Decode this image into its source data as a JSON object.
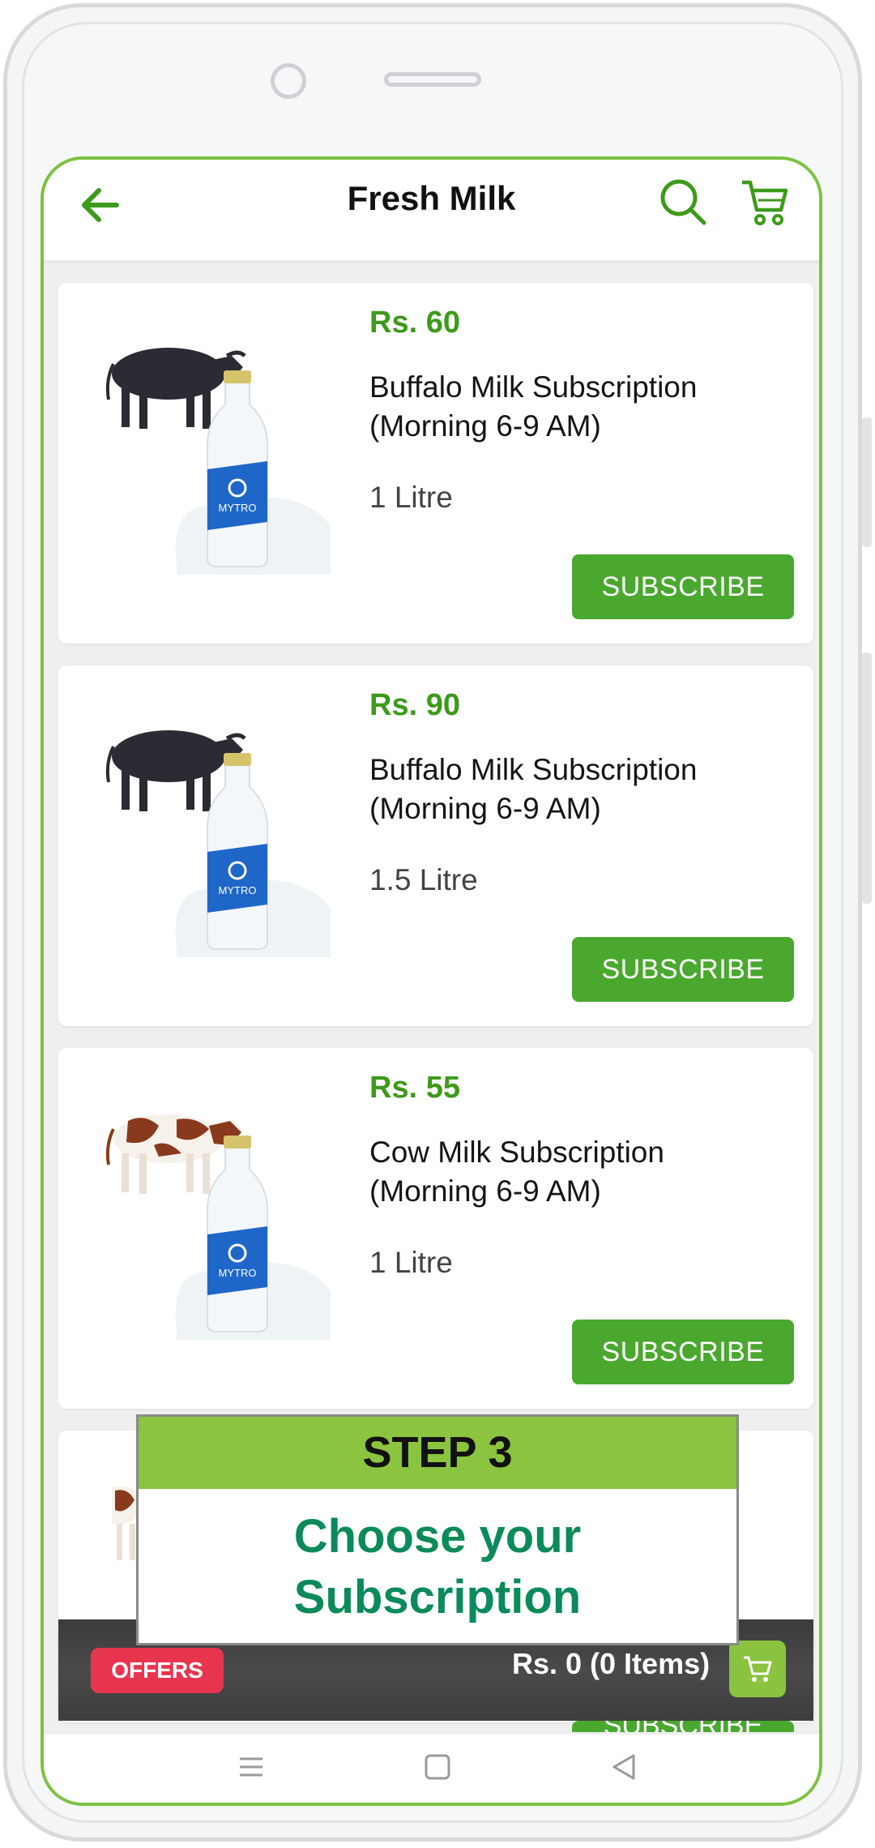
{
  "header": {
    "title": "Fresh Milk"
  },
  "products": [
    {
      "price": "Rs. 60",
      "name_line1": "Buffalo Milk Subscription",
      "name_line2": "(Morning 6-9 AM)",
      "quantity": "1 Litre",
      "button": "SUBSCRIBE",
      "animal": "buffalo"
    },
    {
      "price": "Rs. 90",
      "name_line1": "Buffalo Milk Subscription",
      "name_line2": "(Morning 6-9 AM)",
      "quantity": "1.5 Litre",
      "button": "SUBSCRIBE",
      "animal": "buffalo"
    },
    {
      "price": "Rs. 55",
      "name_line1": "Cow Milk Subscription",
      "name_line2": "(Morning 6-9 AM)",
      "quantity": "1 Litre",
      "button": "SUBSCRIBE",
      "animal": "cow"
    }
  ],
  "bottle_brand": "MYTRO",
  "cart_bar": {
    "offers_label": "OFFERS",
    "total": "Rs. 0 (0 Items)"
  },
  "partial_button": "SUBSCRIBE",
  "overlay": {
    "step": "STEP 3",
    "line1": "Choose your",
    "line2": "Subscription"
  },
  "colors": {
    "accent_green": "#4aa82e",
    "price_green": "#3d9a1a",
    "frame_green": "#7cc242",
    "offers_red": "#e8354f",
    "overlay_text": "#0b8a5a"
  },
  "icons": {
    "back": "arrow-left-icon",
    "search": "search-icon",
    "cart": "cart-icon",
    "nav_menu": "menu-icon",
    "nav_home": "home-square-icon",
    "nav_back": "triangle-back-icon"
  }
}
